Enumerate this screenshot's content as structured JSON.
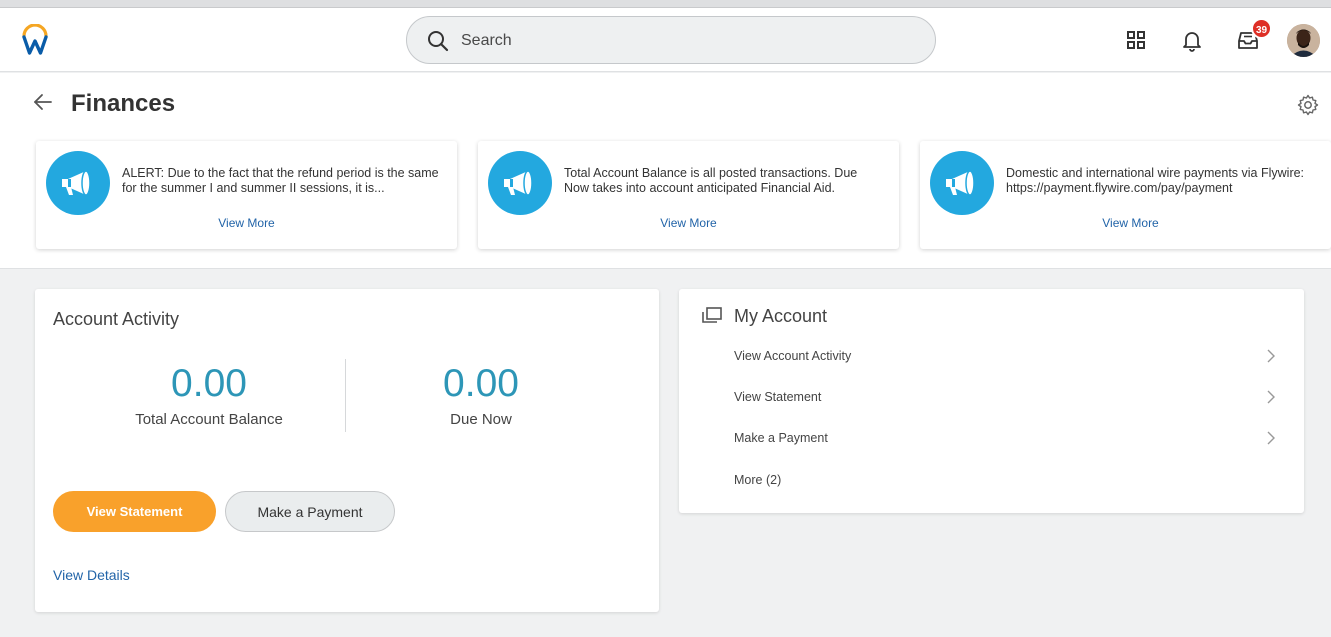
{
  "topbar": {
    "search": {
      "placeholder": "Search"
    },
    "inbox_badge": "39",
    "icons": [
      "workday-logo",
      "search-icon",
      "apps-grid-icon",
      "bell-icon",
      "inbox-icon",
      "avatar"
    ]
  },
  "page": {
    "title": "Finances"
  },
  "announcements": [
    {
      "text": "ALERT: Due to the fact that the refund period is the same for the summer I and summer II sessions, it is...",
      "link": "View More"
    },
    {
      "text": "Total Account Balance is all posted transactions. Due Now takes into account anticipated Financial Aid.",
      "link": "View More"
    },
    {
      "text": "Domestic and international wire payments via Flywire: https://payment.flywire.com/pay/payment",
      "link": "View More"
    }
  ],
  "account_activity": {
    "title": "Account Activity",
    "total_balance": {
      "value": "0.00",
      "label": "Total Account Balance"
    },
    "due_now": {
      "value": "0.00",
      "label": "Due Now"
    },
    "primary_button": "View Statement",
    "secondary_button": "Make a Payment",
    "details_link": "View Details"
  },
  "my_account": {
    "title": "My Account",
    "items": [
      {
        "label": "View Account Activity"
      },
      {
        "label": "View Statement"
      },
      {
        "label": "Make a Payment"
      },
      {
        "label": "More (2)"
      }
    ]
  },
  "colors": {
    "accent_blue": "#2d96b7",
    "link_blue": "#2264a8",
    "primary_orange": "#f9a12b",
    "megaphone_blue": "#23a8df",
    "badge_red": "#de2f26"
  }
}
